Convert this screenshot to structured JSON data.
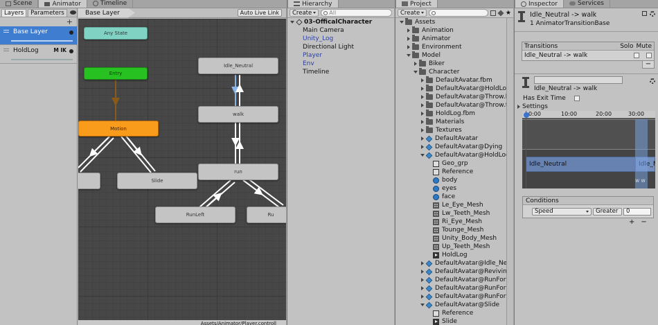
{
  "animator": {
    "tabs": [
      "Scene",
      "Animator",
      "Timeline"
    ],
    "subtabs": [
      "Layers",
      "Parameters"
    ],
    "add_layer": "+",
    "layers": [
      {
        "name": "Base Layer",
        "flags": "",
        "selected": true
      },
      {
        "name": "HoldLog",
        "flags": "M IK",
        "selected": false
      }
    ],
    "breadcrumb": "Base Layer",
    "auto_live_link": "Auto Live Link",
    "states": {
      "any_state": "Any State",
      "entry": "Entry",
      "motion": "Motion",
      "idle": "Idle_Neutral",
      "walk": "walk",
      "run": "run",
      "slide": "Slide",
      "runleft": "RunLeft",
      "run_right_partial": "Ru"
    },
    "footer_path": "Assets/Animator/Player.controll"
  },
  "hierarchy": {
    "tab": "Hierarchy",
    "create": "Create",
    "search_placeholder": "All",
    "scene": "03-OfficalCharacter",
    "items": [
      {
        "label": "Main Camera",
        "blue": false,
        "expand": false
      },
      {
        "label": "Unity_Log",
        "blue": true,
        "expand": false
      },
      {
        "label": "Directional Light",
        "blue": false,
        "expand": false
      },
      {
        "label": "Player",
        "blue": true,
        "expand": true
      },
      {
        "label": "Env",
        "blue": true,
        "expand": true
      },
      {
        "label": "Timeline",
        "blue": false,
        "expand": true
      }
    ]
  },
  "project": {
    "tab": "Project",
    "create": "Create",
    "search_placeholder": "",
    "tree": [
      {
        "label": "Assets",
        "indent": 0,
        "toggle": "open",
        "icon": "folder"
      },
      {
        "label": "Animation",
        "indent": 1,
        "toggle": "closed",
        "icon": "folder"
      },
      {
        "label": "Animator",
        "indent": 1,
        "toggle": "closed",
        "icon": "folder"
      },
      {
        "label": "Environment",
        "indent": 1,
        "toggle": "closed",
        "icon": "folder"
      },
      {
        "label": "Model",
        "indent": 1,
        "toggle": "open",
        "icon": "folder"
      },
      {
        "label": "Biker",
        "indent": 2,
        "toggle": "closed",
        "icon": "folder"
      },
      {
        "label": "Character",
        "indent": 2,
        "toggle": "open",
        "icon": "folder"
      },
      {
        "label": "DefaultAvatar.fbm",
        "indent": 3,
        "toggle": "closed",
        "icon": "folder"
      },
      {
        "label": "DefaultAvatar@HoldLog.fbm",
        "indent": 3,
        "toggle": "closed",
        "icon": "folder"
      },
      {
        "label": "DefaultAvatar@Throw.bck",
        "indent": 3,
        "toggle": "closed",
        "icon": "folder"
      },
      {
        "label": "DefaultAvatar@Throw.fbm",
        "indent": 3,
        "toggle": "closed",
        "icon": "folder"
      },
      {
        "label": "HoldLog.fbm",
        "indent": 3,
        "toggle": "closed",
        "icon": "folder"
      },
      {
        "label": "Materials",
        "indent": 3,
        "toggle": "closed",
        "icon": "folder"
      },
      {
        "label": "Textures",
        "indent": 3,
        "toggle": "closed",
        "icon": "folder"
      },
      {
        "label": "DefaultAvatar",
        "indent": 3,
        "toggle": "closed",
        "icon": "prefab"
      },
      {
        "label": "DefaultAvatar@Dying",
        "indent": 3,
        "toggle": "closed",
        "icon": "prefab"
      },
      {
        "label": "DefaultAvatar@HoldLog",
        "indent": 3,
        "toggle": "open",
        "icon": "prefab"
      },
      {
        "label": "Geo_grp",
        "indent": 4,
        "toggle": "",
        "icon": "go"
      },
      {
        "label": "Reference",
        "indent": 4,
        "toggle": "",
        "icon": "go"
      },
      {
        "label": "body",
        "indent": 4,
        "toggle": "",
        "icon": "mesh"
      },
      {
        "label": "eyes",
        "indent": 4,
        "toggle": "",
        "icon": "mesh"
      },
      {
        "label": "face",
        "indent": 4,
        "toggle": "",
        "icon": "mesh"
      },
      {
        "label": "Le_Eye_Mesh",
        "indent": 4,
        "toggle": "",
        "icon": "grid"
      },
      {
        "label": "Lw_Teeth_Mesh",
        "indent": 4,
        "toggle": "",
        "icon": "grid"
      },
      {
        "label": "Ri_Eye_Mesh",
        "indent": 4,
        "toggle": "",
        "icon": "grid"
      },
      {
        "label": "Tounge_Mesh",
        "indent": 4,
        "toggle": "",
        "icon": "grid"
      },
      {
        "label": "Unity_Body_Mesh",
        "indent": 4,
        "toggle": "",
        "icon": "grid"
      },
      {
        "label": "Up_Teeth_Mesh",
        "indent": 4,
        "toggle": "",
        "icon": "grid"
      },
      {
        "label": "HoldLog",
        "indent": 4,
        "toggle": "",
        "icon": "anim"
      },
      {
        "label": "DefaultAvatar@Idle_Neutra",
        "indent": 3,
        "toggle": "closed",
        "icon": "prefab"
      },
      {
        "label": "DefaultAvatar@Reviving",
        "indent": 3,
        "toggle": "closed",
        "icon": "prefab"
      },
      {
        "label": "DefaultAvatar@RunForwar",
        "indent": 3,
        "toggle": "closed",
        "icon": "prefab"
      },
      {
        "label": "DefaultAvatar@RunForwar",
        "indent": 3,
        "toggle": "closed",
        "icon": "prefab"
      },
      {
        "label": "DefaultAvatar@RunForwar",
        "indent": 3,
        "toggle": "closed",
        "icon": "prefab"
      },
      {
        "label": "DefaultAvatar@Slide",
        "indent": 3,
        "toggle": "open",
        "icon": "prefab"
      },
      {
        "label": "Reference",
        "indent": 4,
        "toggle": "",
        "icon": "go"
      },
      {
        "label": "Slide",
        "indent": 4,
        "toggle": "",
        "icon": "anim"
      }
    ]
  },
  "inspector": {
    "tabs": [
      "Inspector",
      "Services"
    ],
    "title": "Idle_Neutral -> walk",
    "subtitle": "1 AnimatorTransitionBase",
    "transitions_header": "Transitions",
    "solo": "Solo",
    "mute": "Mute",
    "transition_row": "Idle_Neutral -> walk",
    "remove": "−",
    "transition_title": "Idle_Neutral -> walk",
    "has_exit_time": "Has Exit Time",
    "settings": "Settings",
    "timeline": {
      "ticks": [
        "0:00",
        "10:00",
        "20:00",
        "30:00"
      ],
      "state_a": "Idle_Neutral",
      "state_b": "Idle_N",
      "ww": "w w"
    },
    "conditions_header": "Conditions",
    "condition": {
      "param": "Speed",
      "op": "Greater",
      "value": "0"
    },
    "plus": "+",
    "minus": "−"
  }
}
